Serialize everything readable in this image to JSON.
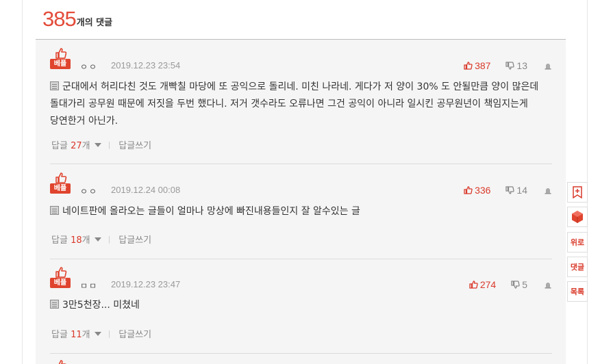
{
  "header": {
    "count": "385",
    "label": "개의 댓글"
  },
  "badge_label": "베플",
  "reply_label": "답글",
  "reply_unit": "개",
  "write_label": "답글쓰기",
  "divider": "|",
  "comments": [
    {
      "author": "ㅇㅇ",
      "date": "2019.12.23 23:54",
      "likes": "387",
      "dislikes": "13",
      "text": "군대에서 허리다친 것도 개빡칠 마당에 또 공익으로 돌리네. 미친 나라네. 게다가 저 양이 30% 도 안될만큼 양이 많은데 돌대가리 공무원 때문에 저짓을 두번 했다니. 저거 갯수라도 오류나면 그건 공익이 아니라 일시킨 공무원년이 책임지는게 당연한거 아닌가.",
      "reply_count": "27"
    },
    {
      "author": "ㅇㅇ",
      "date": "2019.12.24 00:08",
      "likes": "336",
      "dislikes": "14",
      "text": "네이트판에 올라오는 글들이 얼마나 망상에 빠진내용들인지 잘 알수있는 글",
      "reply_count": "18"
    },
    {
      "author": "ㅁㅁ",
      "date": "2019.12.23 23:47",
      "likes": "274",
      "dislikes": "5",
      "text": "3만5천장... 미쳤네",
      "reply_count": "11"
    }
  ],
  "sidebar": {
    "top_label": "위로",
    "comments_label": "댓글",
    "list_label": "목록"
  },
  "colors": {
    "accent": "#e34c3a",
    "badge": "#e0442e",
    "like": "#d9392a"
  }
}
